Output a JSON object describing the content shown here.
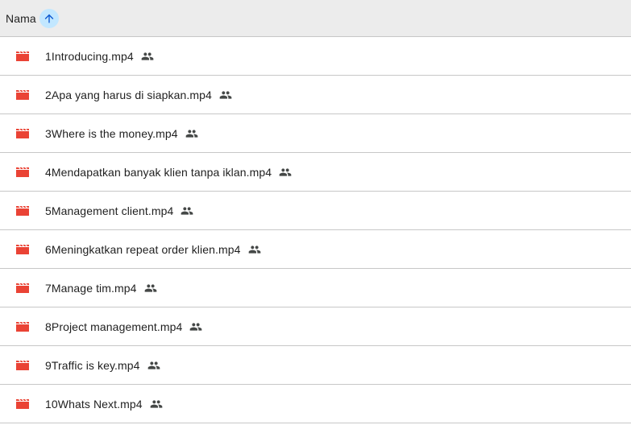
{
  "header": {
    "name_column_label": "Nama",
    "sort_icon": "arrow-up-icon",
    "sort_button_color": "#c2e7ff"
  },
  "colors": {
    "video_icon": "#ea4335",
    "shared_icon": "#444746",
    "header_background": "#ececec",
    "divider": "#c7c7c7"
  },
  "files": [
    {
      "name": "1Introducing.mp4",
      "icon": "video-file-icon",
      "shared": true,
      "shared_icon": "people-icon"
    },
    {
      "name": "2Apa yang harus di siapkan.mp4",
      "icon": "video-file-icon",
      "shared": true,
      "shared_icon": "people-icon"
    },
    {
      "name": "3Where is the money.mp4",
      "icon": "video-file-icon",
      "shared": true,
      "shared_icon": "people-icon"
    },
    {
      "name": "4Mendapatkan banyak klien tanpa iklan.mp4",
      "icon": "video-file-icon",
      "shared": true,
      "shared_icon": "people-icon"
    },
    {
      "name": "5Management client.mp4",
      "icon": "video-file-icon",
      "shared": true,
      "shared_icon": "people-icon"
    },
    {
      "name": "6Meningkatkan repeat order klien.mp4",
      "icon": "video-file-icon",
      "shared": true,
      "shared_icon": "people-icon"
    },
    {
      "name": "7Manage tim.mp4",
      "icon": "video-file-icon",
      "shared": true,
      "shared_icon": "people-icon"
    },
    {
      "name": "8Project management.mp4",
      "icon": "video-file-icon",
      "shared": true,
      "shared_icon": "people-icon"
    },
    {
      "name": "9Traffic is key.mp4",
      "icon": "video-file-icon",
      "shared": true,
      "shared_icon": "people-icon"
    },
    {
      "name": "10Whats Next.mp4",
      "icon": "video-file-icon",
      "shared": true,
      "shared_icon": "people-icon"
    }
  ]
}
